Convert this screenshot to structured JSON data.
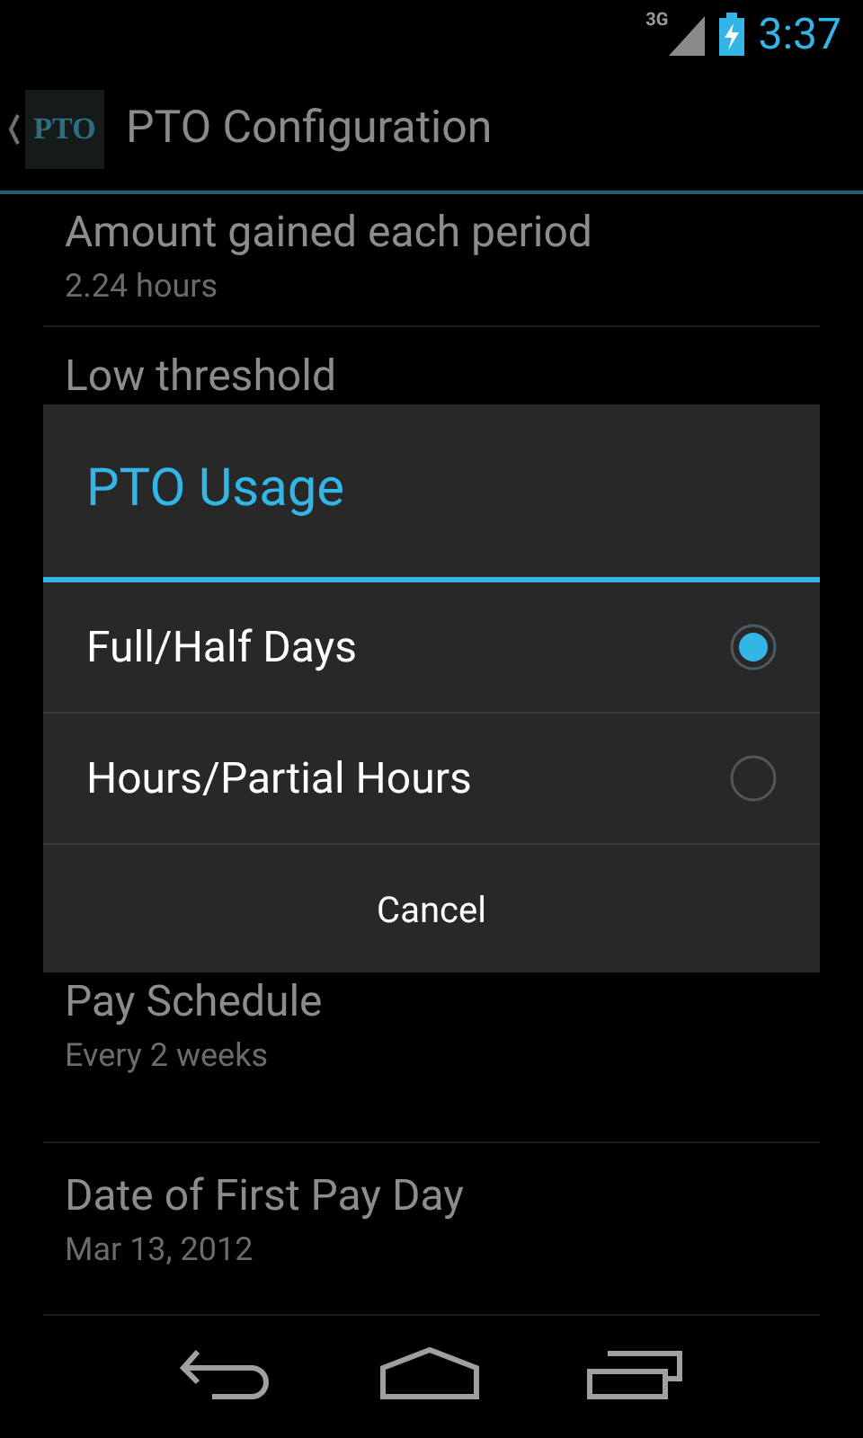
{
  "status_bar": {
    "network": "3G",
    "time": "3:37"
  },
  "action_bar": {
    "app_icon": "PTO",
    "title": "PTO Configuration"
  },
  "settings": [
    {
      "title": "Amount gained each period",
      "summary": "2.24 hours"
    },
    {
      "title": "Low threshold"
    },
    {
      "title": "Pay Schedule",
      "summary": "Every 2 weeks"
    },
    {
      "title": "Date of First Pay Day",
      "summary": "Mar 13, 2012"
    }
  ],
  "dialog": {
    "title": "PTO Usage",
    "options": [
      {
        "label": "Full/Half Days",
        "selected": true
      },
      {
        "label": "Hours/Partial Hours",
        "selected": false
      }
    ],
    "buttons": [
      "Cancel"
    ]
  }
}
